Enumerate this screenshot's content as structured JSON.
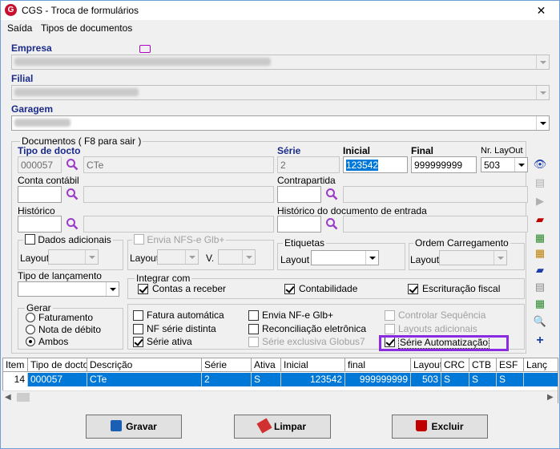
{
  "window": {
    "title": "CGS - Troca de formulários",
    "close": "✕",
    "logo": "G"
  },
  "menu": {
    "items": [
      "Saída",
      "Tipos de documentos"
    ]
  },
  "empresa": {
    "label": "Empresa"
  },
  "filial": {
    "label": "Filial"
  },
  "garagem": {
    "label": "Garagem"
  },
  "documentos": {
    "group_title": "Documentos ( F8 para sair )",
    "tipo_docto_label": "Tipo de docto",
    "tipo_docto_code": "000057",
    "tipo_docto_desc": "CTe",
    "serie_label": "Série",
    "serie_value": "2",
    "inicial_label": "Inicial",
    "inicial_value": "123542",
    "final_label": "Final",
    "final_value": "999999999",
    "nr_layout_label": "Nr. LayOut",
    "nr_layout_value": "503",
    "conta_contabil_label": "Conta contábil",
    "contrapartida_label": "Contrapartida",
    "historico_label": "Histórico",
    "historico_entrada_label": "Histórico do documento de entrada",
    "dados_adicionais_label": "Dados adicionais",
    "layout_label": "Layout",
    "envia_nfse_label": "Envia NFS-e Glb+",
    "v_label": "V.",
    "etiquetas_label": "Etiquetas",
    "ordem_carregamento_label": "Ordem Carregamento",
    "tipo_lancamento_label": "Tipo de lançamento",
    "integrar_com_label": "Integrar com",
    "contas_receber_label": "Contas a receber",
    "contabilidade_label": "Contabilidade",
    "escrituracao_fiscal_label": "Escrituração fiscal",
    "gerar_label": "Gerar",
    "gerar_options": [
      "Faturamento",
      "Nota de débito",
      "Ambos"
    ],
    "fatura_automatica": "Fatura automática",
    "nf_serie_distinta": "NF série distinta",
    "serie_ativa": "Série ativa",
    "envia_nfe": "Envia NF-e Glb+",
    "reconciliacao": "Reconciliação eletrônica",
    "serie_exclusiva": "Série exclusiva Globus7",
    "controlar_sequencia": "Controlar Sequência",
    "layouts_adicionais": "Layouts adicionais",
    "serie_automatizacao": "Série Automatização"
  },
  "grid": {
    "headers": [
      "Item",
      "Tipo de docto",
      "Descrição",
      "Série",
      "Ativa",
      "Inicial",
      "final",
      "Layout",
      "CRC",
      "CTB",
      "ESF",
      "Lanç"
    ],
    "row": [
      "14",
      "000057",
      "CTe",
      "2",
      "S",
      "123542",
      "999999999",
      "503",
      "S",
      "S",
      "S",
      ""
    ]
  },
  "buttons": {
    "gravar": "Gravar",
    "limpar": "Limpar",
    "excluir": "Excluir"
  },
  "colors": {
    "label_blue": "#1a2a8a",
    "selection": "#0078d7",
    "highlight": "#8a2be2"
  }
}
